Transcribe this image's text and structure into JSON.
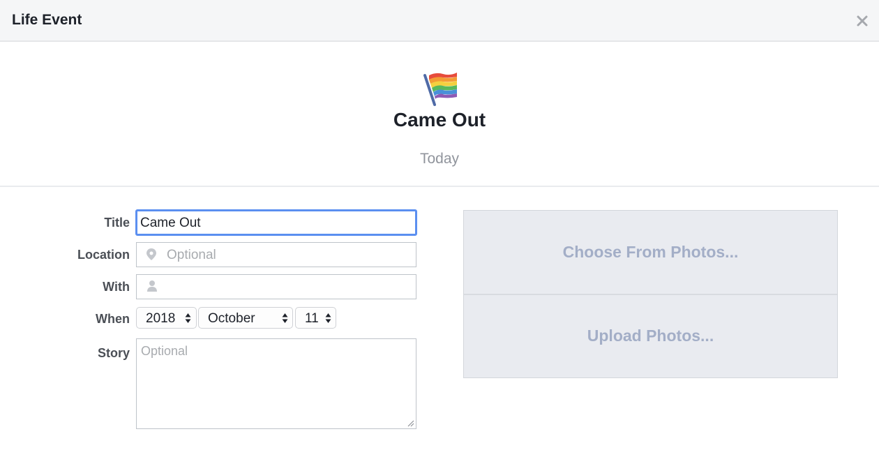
{
  "dialog": {
    "title": "Life Event",
    "close_icon": "close-icon"
  },
  "event": {
    "icon": "rainbow-flag-icon",
    "title": "Came Out",
    "date_label": "Today"
  },
  "form": {
    "title": {
      "label": "Title",
      "value": "Came Out"
    },
    "location": {
      "label": "Location",
      "placeholder": "Optional",
      "icon": "location-pin-icon"
    },
    "with": {
      "label": "With",
      "placeholder": "",
      "icon": "person-icon"
    },
    "when": {
      "label": "When",
      "year": "2018",
      "month": "October",
      "day": "11"
    },
    "story": {
      "label": "Story",
      "placeholder": "Optional"
    }
  },
  "photos": {
    "choose_label": "Choose From Photos...",
    "upload_label": "Upload Photos..."
  },
  "colors": {
    "focus_border": "#5b8ff0",
    "photo_text": "#a3aec7",
    "photo_bg": "#e9ebf0"
  }
}
